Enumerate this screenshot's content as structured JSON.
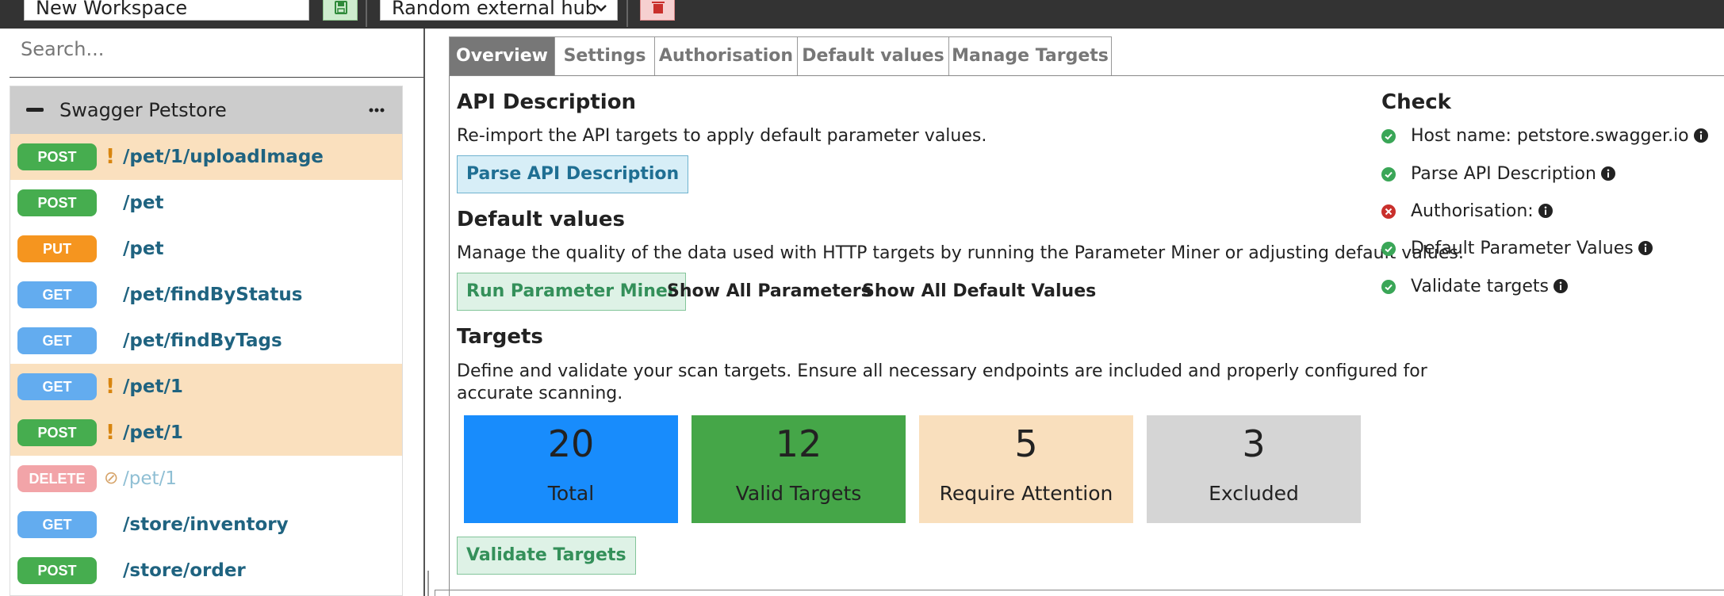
{
  "toolbar": {
    "workspace_name": "New Workspace",
    "hub_selected": "Random external hub"
  },
  "sidebar": {
    "search_placeholder": "Search...",
    "group_title": "Swagger Petstore",
    "items": [
      {
        "method": "POST",
        "path": "/pet/1/uploadImage",
        "state": "attention"
      },
      {
        "method": "POST",
        "path": "/pet",
        "state": "normal"
      },
      {
        "method": "PUT",
        "path": "/pet",
        "state": "normal"
      },
      {
        "method": "GET",
        "path": "/pet/findByStatus",
        "state": "normal"
      },
      {
        "method": "GET",
        "path": "/pet/findByTags",
        "state": "normal"
      },
      {
        "method": "GET",
        "path": "/pet/1",
        "state": "attention"
      },
      {
        "method": "POST",
        "path": "/pet/1",
        "state": "attention"
      },
      {
        "method": "DELETE",
        "path": "/pet/1",
        "state": "excluded"
      },
      {
        "method": "GET",
        "path": "/store/inventory",
        "state": "normal"
      },
      {
        "method": "POST",
        "path": "/store/order",
        "state": "normal"
      }
    ]
  },
  "tabs": [
    "Overview",
    "Settings",
    "Authorisation",
    "Default values",
    "Manage Targets"
  ],
  "overview": {
    "api_description": {
      "heading": "API Description",
      "text": "Re-import the API targets to apply default parameter values.",
      "button": "Parse API Description"
    },
    "default_values": {
      "heading": "Default values",
      "text": "Manage the quality of the data used with HTTP targets by running the Parameter Miner or adjusting default values.",
      "run_button": "Run Parameter Miner",
      "show_params": "Show All Parameters",
      "show_defaults": "Show All Default Values"
    },
    "targets": {
      "heading": "Targets",
      "text_line1": "Define and validate your scan targets. Ensure all necessary endpoints are included and properly configured for",
      "text_line2": "accurate scanning.",
      "cards": [
        {
          "value": "20",
          "label": "Total"
        },
        {
          "value": "12",
          "label": "Valid Targets"
        },
        {
          "value": "5",
          "label": "Require Attention"
        },
        {
          "value": "3",
          "label": "Excluded"
        }
      ],
      "validate_button": "Validate Targets"
    }
  },
  "check": {
    "title": "Check",
    "items": [
      {
        "label": "Host name: petstore.swagger.io",
        "status": "ok"
      },
      {
        "label": "Parse API Description",
        "status": "ok"
      },
      {
        "label": "Authorisation:",
        "status": "error"
      },
      {
        "label": "Default Parameter Values",
        "status": "ok"
      },
      {
        "label": "Validate targets",
        "status": "ok"
      }
    ]
  },
  "colors": {
    "post": "#46ad4f",
    "put": "#f5951f",
    "get": "#63acef",
    "delete": "#f2a4a8",
    "attention_bg": "#fae0be",
    "total": "#188cfc",
    "valid": "#45a648",
    "excluded": "#d5d5d5",
    "ok": "#3aa657",
    "error": "#c9302c"
  }
}
